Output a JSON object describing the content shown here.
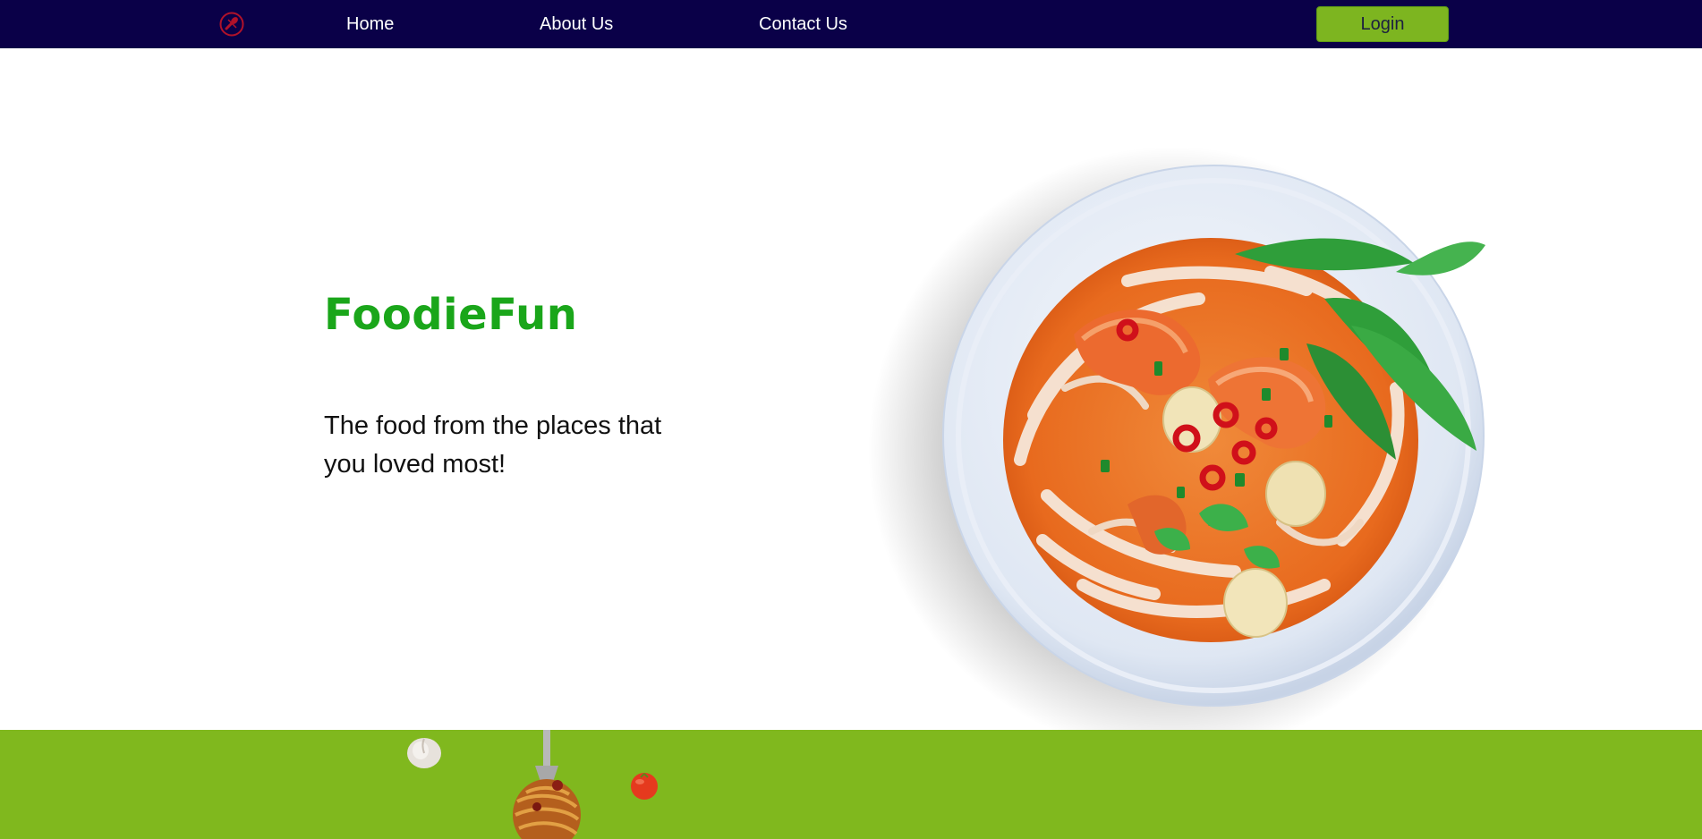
{
  "nav": {
    "logo_icon": "food-logo-icon",
    "links": [
      {
        "label": "Home"
      },
      {
        "label": "About Us"
      },
      {
        "label": "Contact Us"
      }
    ],
    "login_label": "Login"
  },
  "hero": {
    "brand": "FoodieFun",
    "tagline": "The food from the places that you loved most!",
    "image_icon": "noodle-soup-bowl-image"
  },
  "footer": {
    "decorations": [
      "garlic-icon",
      "spaghetti-fork-icon",
      "tomato-icon"
    ]
  },
  "colors": {
    "navbar": "#0a0048",
    "accent_green": "#7db520",
    "brand_green": "#1aa61a",
    "footer_band": "#80b81e",
    "logo_red": "#b0122a"
  }
}
